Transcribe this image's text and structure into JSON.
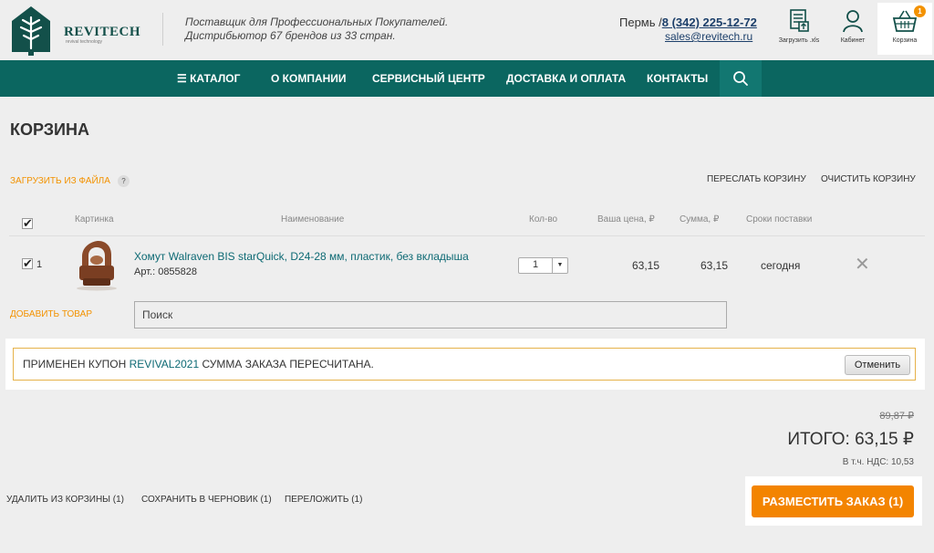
{
  "header": {
    "brand": "REVITECH",
    "brand_sub": "revival technology",
    "tagline_1": "Поставщик для Профессиональных Покупателей.",
    "tagline_2": "Дистрибьютор 67 брендов из 33 стран.",
    "city": "Пермь /",
    "phone": "8 (342) 225-12-72",
    "email": "sales@revitech.ru",
    "upload_label": "Загрузить .xls",
    "cabinet_label": "Кабинет",
    "cart_label": "Корзина",
    "cart_count": "1",
    "icons": {
      "upload": "upload-xls-icon",
      "cabinet": "user-icon",
      "cart": "basket-icon",
      "search": "search-icon"
    }
  },
  "nav": {
    "catalog": "☰ КАТАЛОГ",
    "about": "О КОМПАНИИ",
    "service": "СЕРВИСНЫЙ ЦЕНТР",
    "delivery": "ДОСТАВКА И ОПЛАТА",
    "contacts": "КОНТАКТЫ"
  },
  "cart": {
    "title": "КОРЗИНА",
    "upload_file": "ЗАГРУЗИТЬ ИЗ ФАЙЛА",
    "help": "?",
    "forward": "ПЕРЕСЛАТЬ КОРЗИНУ",
    "clear": "ОЧИСТИТЬ КОРЗИНУ",
    "columns": {
      "image": "Картинка",
      "name": "Наименование",
      "qty": "Кол-во",
      "price": "Ваша цена, ₽",
      "sum": "Сумма, ₽",
      "delivery": "Сроки поставки"
    },
    "items": [
      {
        "num": "1",
        "checked": true,
        "name": "Хомут Walraven BIS starQuick, D24-28 мм, пластик, без вкладыша",
        "article": "Арт.: 0855828",
        "qty": "1",
        "price": "63,15",
        "sum": "63,15",
        "delivery": "сегодня"
      }
    ],
    "add_item": "ДОБАВИТЬ ТОВАР",
    "search_placeholder": "Поиск"
  },
  "coupon": {
    "prefix": "ПРИМЕНЕН КУПОН ",
    "code": "REVIVAL2021",
    "suffix": " СУММА ЗАКАЗА ПЕРЕСЧИТАНА.",
    "cancel": "Отменить"
  },
  "totals": {
    "old_price": "89,87 ₽",
    "total": "ИТОГО: 63,15 ₽",
    "vat": "В т.ч. НДС: 10,53"
  },
  "actions": {
    "delete": "УДАЛИТЬ ИЗ КОРЗИНЫ (1)",
    "draft": "СОХРАНИТЬ В ЧЕРНОВИК (1)",
    "move": "ПЕРЕЛОЖИТЬ (1)",
    "place_order": "РАЗМЕСТИТЬ ЗАКАЗ (1)"
  },
  "colors": {
    "accent_teal": "#0b6660",
    "accent_orange": "#f38400",
    "background": "#eeeeee"
  }
}
